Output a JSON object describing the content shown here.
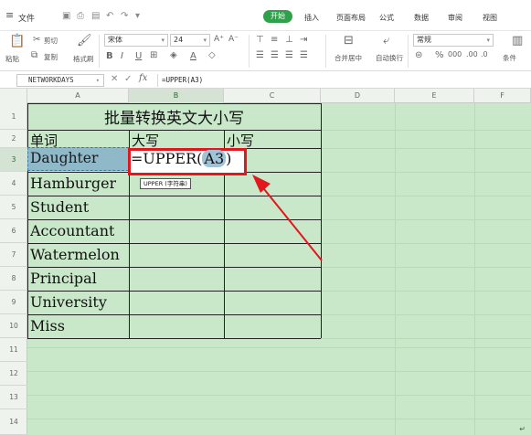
{
  "menubar": {
    "file_label": "文件",
    "tabs": [
      "开始",
      "插入",
      "页面布局",
      "公式",
      "数据",
      "审阅",
      "视图"
    ],
    "active_tab": "开始"
  },
  "ribbon": {
    "paste_label": "粘贴",
    "cut_label": "剪切",
    "copy_label": "复制",
    "format_painter_label": "格式刷",
    "font_name": "宋体",
    "font_size": "24",
    "merge_label": "合并居中",
    "wrap_label": "自动换行",
    "number_format": "常规",
    "cond_format_label": "条件"
  },
  "formula_bar": {
    "name_box": "NETWORKDAYS",
    "fx_label": "fx",
    "content": "=UPPER(A3)"
  },
  "columns": [
    "A",
    "B",
    "C",
    "D",
    "E",
    "F"
  ],
  "rows": [
    "1",
    "2",
    "3",
    "4",
    "5",
    "6",
    "7",
    "8",
    "9",
    "10",
    "11",
    "12",
    "13",
    "14"
  ],
  "table": {
    "title": "批量转换英文大小写",
    "header_word": "单词",
    "header_upper": "大写",
    "header_lower": "小写",
    "words": [
      "Daughter",
      "Hamburger",
      "Student",
      "Accountant",
      "Watermelon",
      "Principal",
      "University",
      "Miss"
    ]
  },
  "editing_cell": {
    "formula_prefix": "=UPPER(",
    "formula_ref": "A3",
    "formula_suffix": ")",
    "tooltip": "UPPER (字符串)"
  },
  "colors": {
    "sheet_bg": "#c9e8c9",
    "highlight_red": "#e3161d",
    "active_tab": "#2fa14b"
  }
}
